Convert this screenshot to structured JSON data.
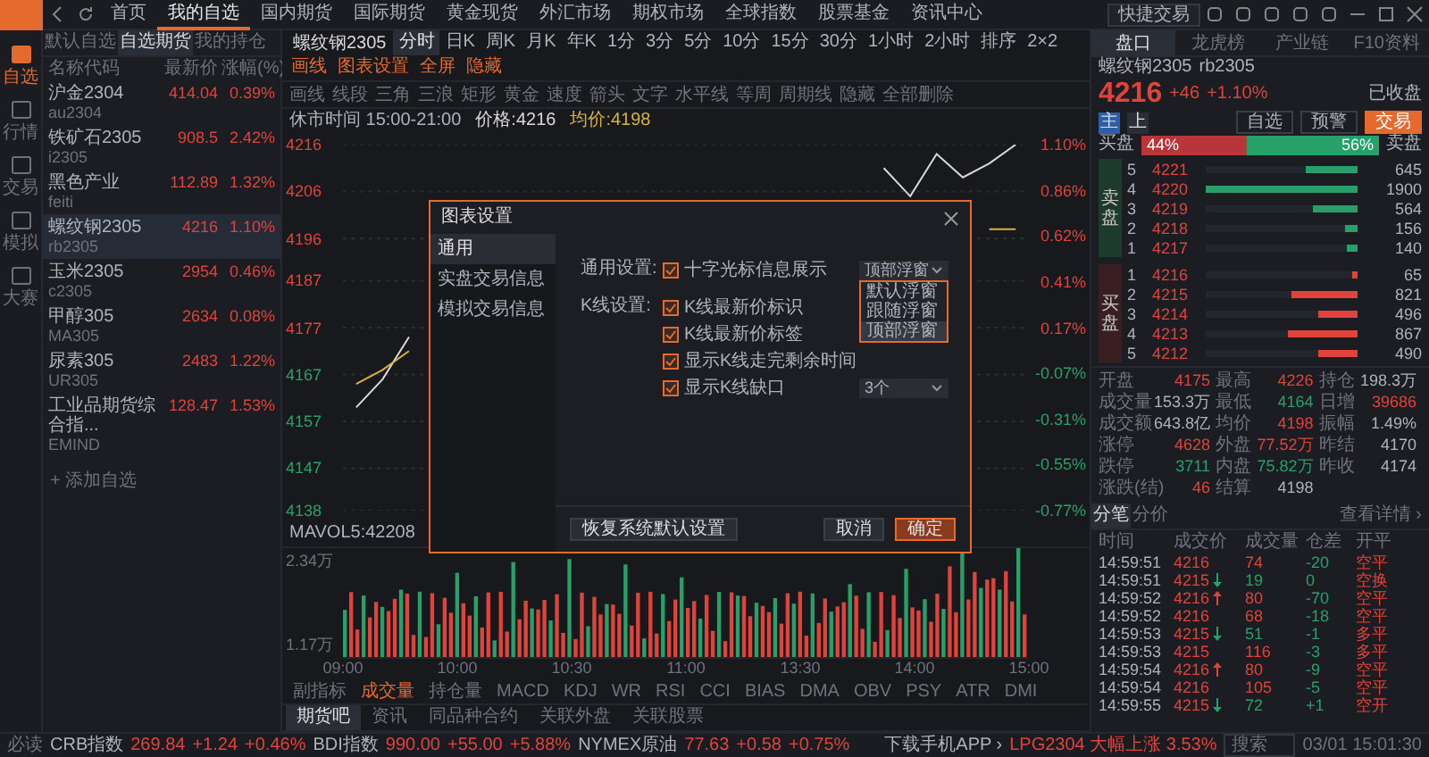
{
  "top_nav": {
    "items": [
      {
        "label": "首页",
        "selected": false
      },
      {
        "label": "我的自选",
        "selected": true
      },
      {
        "label": "国内期货",
        "selected": false
      },
      {
        "label": "国际期货",
        "selected": false
      },
      {
        "label": "黄金现货",
        "selected": false
      },
      {
        "label": "外汇市场",
        "selected": false
      },
      {
        "label": "期权市场",
        "selected": false
      },
      {
        "label": "全球指数",
        "selected": false
      },
      {
        "label": "股票基金",
        "selected": false
      },
      {
        "label": "资讯中心",
        "selected": false
      }
    ],
    "quick_trade": "快捷交易"
  },
  "rail": [
    {
      "label": "自选",
      "selected": true
    },
    {
      "label": "行情",
      "selected": false
    },
    {
      "label": "交易",
      "selected": false
    },
    {
      "label": "模拟",
      "selected": false
    },
    {
      "label": "大赛",
      "selected": false
    }
  ],
  "watchlist": {
    "tabs": [
      {
        "label": "默认自选",
        "selected": false
      },
      {
        "label": "自选期货",
        "selected": true
      },
      {
        "label": "我的持仓",
        "selected": false
      }
    ],
    "columns": [
      "名称代码",
      "最新价",
      "涨幅(%)"
    ],
    "rows": [
      {
        "name": "沪金2304",
        "code": "au2304",
        "price": "414.04",
        "change": "0.39%",
        "selected": false
      },
      {
        "name": "铁矿石2305",
        "code": "i2305",
        "price": "908.5",
        "change": "2.42%",
        "selected": false
      },
      {
        "name": "黑色产业",
        "code": "feiti",
        "price": "112.89",
        "change": "1.32%",
        "selected": false
      },
      {
        "name": "螺纹钢2305",
        "code": "rb2305",
        "price": "4216",
        "change": "1.10%",
        "selected": true
      },
      {
        "name": "玉米2305",
        "code": "c2305",
        "price": "2954",
        "change": "0.46%",
        "selected": false
      },
      {
        "name": "甲醇305",
        "code": "MA305",
        "price": "2634",
        "change": "0.08%",
        "selected": false
      },
      {
        "name": "尿素305",
        "code": "UR305",
        "price": "2483",
        "change": "1.22%",
        "selected": false
      },
      {
        "name": "工业品期货综合指...",
        "code": "EMIND",
        "price": "128.47",
        "change": "1.53%",
        "selected": false
      }
    ],
    "add": "+ 添加自选"
  },
  "chart": {
    "symbol": "螺纹钢2305",
    "periods": [
      {
        "label": "分时",
        "selected": true
      },
      {
        "label": "日K",
        "selected": false
      },
      {
        "label": "周K",
        "selected": false
      },
      {
        "label": "月K",
        "selected": false
      },
      {
        "label": "年K",
        "selected": false
      },
      {
        "label": "1分",
        "selected": false
      },
      {
        "label": "3分",
        "selected": false
      },
      {
        "label": "5分",
        "selected": false
      },
      {
        "label": "10分",
        "selected": false
      },
      {
        "label": "15分",
        "selected": false
      },
      {
        "label": "30分",
        "selected": false
      },
      {
        "label": "1小时",
        "selected": false
      },
      {
        "label": "2小时",
        "selected": false
      }
    ],
    "actions": [
      "排序",
      "2×2",
      "画线",
      "图表设置",
      "全屏",
      "隐藏"
    ],
    "tools": [
      "画线",
      "线段",
      "三角",
      "三浪",
      "矩形",
      "黄金",
      "速度",
      "箭头",
      "文字",
      "水平线",
      "等周",
      "周期线",
      "隐藏",
      "全部删除"
    ],
    "info": "休市时间 15:00-21:00",
    "chart_data": {
      "type": "line",
      "grid": true,
      "series": [
        {
          "name": "价格:4216",
          "color": "#d8d8d8",
          "values": [
            4160,
            4166,
            4175,
            null,
            null,
            null,
            null,
            null,
            null,
            null,
            null,
            null,
            null,
            null,
            null,
            null,
            null,
            null,
            null,
            null,
            4211,
            4205,
            4214,
            4209,
            4212,
            4216
          ]
        },
        {
          "name": "均价:4198",
          "color": "#d6b43a",
          "values": [
            4165,
            4168,
            4172,
            null,
            null,
            null,
            null,
            null,
            null,
            null,
            null,
            null,
            null,
            null,
            null,
            null,
            null,
            null,
            null,
            null,
            null,
            null,
            null,
            null,
            4198,
            4198
          ]
        }
      ],
      "ylim": [
        4138,
        4216
      ],
      "yticks": [
        {
          "value": 4216,
          "label": "4216"
        },
        {
          "value": 4206,
          "label": "4206"
        },
        {
          "value": 4196,
          "label": "4196"
        },
        {
          "value": 4187,
          "label": "4187"
        },
        {
          "value": 4177,
          "label": "4177"
        },
        {
          "value": 4167,
          "label": "4167"
        },
        {
          "value": 4157,
          "label": "4157"
        },
        {
          "value": 4147,
          "label": "4147"
        },
        {
          "value": 4138,
          "label": "4138"
        }
      ]
    },
    "times": [
      "09:00",
      "10:00",
      "10:30",
      "11:00",
      "13:30",
      "14:00",
      "15:00"
    ],
    "pct_labels": [
      "1.10%",
      "0.86%",
      "0.62%",
      "0.41%",
      "0.17%",
      "-0.07%",
      "-0.31%",
      "-0.55%",
      "-0.77%"
    ],
    "volume_label": "MAVOL5:42208",
    "volume_axis": [
      "2.34万",
      "1.17万"
    ],
    "indicators": [
      {
        "label": "副指标",
        "selected": false
      },
      {
        "label": "成交量",
        "selected": true
      },
      {
        "label": "持仓量",
        "selected": false
      },
      {
        "label": "MACD",
        "selected": false
      },
      {
        "label": "KDJ",
        "selected": false
      },
      {
        "label": "WR",
        "selected": false
      },
      {
        "label": "RSI",
        "selected": false
      },
      {
        "label": "CCI",
        "selected": false
      },
      {
        "label": "BIAS",
        "selected": false
      },
      {
        "label": "DMA",
        "selected": false
      },
      {
        "label": "OBV",
        "selected": false
      },
      {
        "label": "PSY",
        "selected": false
      },
      {
        "label": "ATR",
        "selected": false
      },
      {
        "label": "DMI",
        "selected": false
      }
    ],
    "bottom_tabs": [
      {
        "label": "期货吧",
        "selected": true
      },
      {
        "label": "资讯",
        "selected": false
      },
      {
        "label": "同品种合约",
        "selected": false
      },
      {
        "label": "关联外盘",
        "selected": false
      },
      {
        "label": "关联股票",
        "selected": false
      }
    ]
  },
  "dialog": {
    "title": "图表设置",
    "nav": [
      {
        "label": "通用",
        "selected": true
      },
      {
        "label": "实盘交易信息",
        "selected": false
      },
      {
        "label": "模拟交易信息",
        "selected": false
      }
    ],
    "sections": [
      {
        "label": "通用设置:",
        "options": [
          {
            "label": "十字光标信息展示",
            "checked": true,
            "select": {
              "value": "顶部浮窗",
              "expanded": true,
              "options": [
                {
                  "label": "默认浮窗",
                  "selected": false
                },
                {
                  "label": "跟随浮窗",
                  "selected": false
                },
                {
                  "label": "顶部浮窗",
                  "selected": true
                }
              ]
            }
          }
        ]
      },
      {
        "label": "K线设置:",
        "options": [
          {
            "label": "K线最新价标识",
            "checked": true
          },
          {
            "label": "K线最新价标签",
            "checked": true
          },
          {
            "label": "显示K线走完剩余时间",
            "checked": true
          },
          {
            "label": "显示K线缺口",
            "checked": true,
            "select": {
              "value": "3个",
              "expanded": false
            }
          }
        ]
      }
    ],
    "reset": "恢复系统默认设置",
    "cancel": "取消",
    "ok": "确定"
  },
  "quote": {
    "tabs": [
      {
        "label": "盘口",
        "selected": true
      },
      {
        "label": "龙虎榜",
        "selected": false
      },
      {
        "label": "产业链",
        "selected": false
      },
      {
        "label": "F10资料",
        "selected": false
      }
    ],
    "name": "螺纹钢2305",
    "code": "rb2305",
    "price": "4216",
    "change": "+46",
    "change_pct": "+1.10%",
    "status": "已收盘",
    "modes": [
      {
        "label": "主",
        "selected": true
      },
      {
        "label": "上",
        "selected": false
      }
    ],
    "buttons": [
      "自选",
      "预警",
      "交易"
    ],
    "ratio": {
      "buy_label": "买盘",
      "buy_pct": "44%",
      "sell_pct": "56%",
      "sell_label": "卖盘",
      "level": 0.44
    },
    "asks_label": "卖盘",
    "bids_label": "买盘",
    "asks": [
      {
        "rank": "5",
        "price": "4221",
        "volume": "645",
        "level": 0.34
      },
      {
        "rank": "4",
        "price": "4220",
        "volume": "1900",
        "level": 1
      },
      {
        "rank": "3",
        "price": "4219",
        "volume": "564",
        "level": 0.3
      },
      {
        "rank": "2",
        "price": "4218",
        "volume": "156",
        "level": 0.08
      },
      {
        "rank": "1",
        "price": "4217",
        "volume": "140",
        "level": 0.07
      }
    ],
    "bids": [
      {
        "rank": "1",
        "price": "4216",
        "volume": "65",
        "level": 0.03
      },
      {
        "rank": "2",
        "price": "4215",
        "volume": "821",
        "level": 0.43
      },
      {
        "rank": "3",
        "price": "4214",
        "volume": "496",
        "level": 0.26
      },
      {
        "rank": "4",
        "price": "4213",
        "volume": "867",
        "level": 0.46
      },
      {
        "rank": "5",
        "price": "4212",
        "volume": "490",
        "level": 0.26
      }
    ],
    "stats": [
      {
        "label": "开盘",
        "value": "4175",
        "color": "#e0433b"
      },
      {
        "label": "最高",
        "value": "4226",
        "color": "#e0433b"
      },
      {
        "label": "持仓",
        "value": "198.3万",
        "color": "#aeb3bc"
      },
      {
        "label": "成交量",
        "value": "153.3万",
        "color": "#aeb3bc"
      },
      {
        "label": "最低",
        "value": "4164",
        "color": "#27a069"
      },
      {
        "label": "日增",
        "value": "39686",
        "color": "#e0433b"
      },
      {
        "label": "成交额",
        "value": "643.8亿",
        "color": "#aeb3bc"
      },
      {
        "label": "均价",
        "value": "4198",
        "color": "#e0433b"
      },
      {
        "label": "振幅",
        "value": "1.49%",
        "color": "#aeb3bc"
      },
      {
        "label": "涨停",
        "value": "4628",
        "color": "#e0433b"
      },
      {
        "label": "外盘",
        "value": "77.52万",
        "color": "#e0433b"
      },
      {
        "label": "昨结",
        "value": "4170",
        "color": "#aeb3bc"
      },
      {
        "label": "跌停",
        "value": "3711",
        "color": "#27a069"
      },
      {
        "label": "内盘",
        "value": "75.82万",
        "color": "#27a069"
      },
      {
        "label": "昨收",
        "value": "4174",
        "color": "#aeb3bc"
      },
      {
        "label": "涨跌(结)",
        "value": "46",
        "color": "#e0433b"
      },
      {
        "label": "结算",
        "value": "4198",
        "color": "#aeb3bc"
      }
    ],
    "trade_tabs": [
      {
        "label": "分笔",
        "selected": true
      },
      {
        "label": "分价",
        "selected": false
      }
    ],
    "detail_link": "查看详情 ›",
    "trade_columns": [
      "时间",
      "成交价",
      "成交量",
      "仓差",
      "开平"
    ],
    "trades": [
      {
        "time": "14:59:51",
        "price": "4216",
        "kind": "plain",
        "volume": "74",
        "diff": "-20",
        "type": "空平"
      },
      {
        "time": "14:59:51",
        "price": "4215",
        "kind": "down",
        "volume": "19",
        "diff": "0",
        "type": "空换"
      },
      {
        "time": "14:59:52",
        "price": "4216",
        "kind": "up",
        "volume": "80",
        "diff": "-70",
        "type": "空平"
      },
      {
        "time": "14:59:52",
        "price": "4216",
        "kind": "plain",
        "volume": "68",
        "diff": "-18",
        "type": "空平"
      },
      {
        "time": "14:59:53",
        "price": "4215",
        "kind": "down",
        "volume": "51",
        "diff": "-1",
        "type": "多平"
      },
      {
        "time": "14:59:53",
        "price": "4215",
        "kind": "plain",
        "volume": "116",
        "diff": "-3",
        "type": "多平"
      },
      {
        "time": "14:59:54",
        "price": "4216",
        "kind": "up",
        "volume": "80",
        "diff": "-9",
        "type": "空平"
      },
      {
        "time": "14:59:54",
        "price": "4216",
        "kind": "plain",
        "volume": "105",
        "diff": "-5",
        "type": "空平"
      },
      {
        "time": "14:59:55",
        "price": "4215",
        "kind": "down",
        "volume": "72",
        "diff": "+1",
        "type": "空开"
      }
    ]
  },
  "status_bar": {
    "lead": "必读",
    "indices": [
      {
        "name": "CRB指数",
        "value": "269.84",
        "change": "+1.24",
        "pct": "+0.46%"
      },
      {
        "name": "BDI指数",
        "value": "990.00",
        "change": "+55.00",
        "pct": "+5.88%"
      },
      {
        "name": "NYMEX原油",
        "value": "77.63",
        "change": "+0.58",
        "pct": "+0.75%"
      }
    ],
    "app_link": "下载手机APP ›",
    "ticker": "LPG2304 大幅上涨 3.53%",
    "search": "搜索",
    "time": "03/01 15:01:30"
  }
}
